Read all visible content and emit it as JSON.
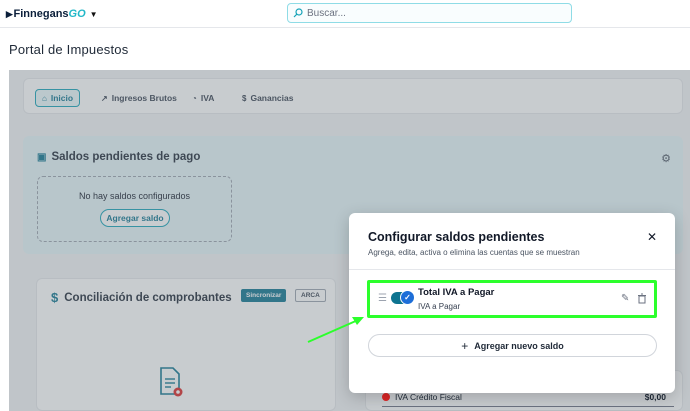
{
  "app": {
    "brand": "Finnegans",
    "brand_suffix": "GO"
  },
  "search": {
    "placeholder": "Buscar..."
  },
  "page": {
    "title": "Portal de Impuestos"
  },
  "tabs": [
    {
      "label": "Inicio",
      "icon": "home-icon",
      "active": true
    },
    {
      "label": "Ingresos Brutos",
      "icon": "trending-up-icon",
      "active": false
    },
    {
      "label": "IVA",
      "icon": "pie-chart-icon",
      "active": false
    },
    {
      "label": "Ganancias",
      "icon": "dollar-icon",
      "active": false
    }
  ],
  "saldos": {
    "title": "Saldos pendientes de pago",
    "empty_text": "No hay saldos configurados",
    "add_button": "Agregar saldo"
  },
  "conciliacion": {
    "title": "Conciliación de comprobantes",
    "sync_button": "Sincronizar",
    "arca_button": "ARCA"
  },
  "iva_row": {
    "label": "IVA Crédito Fiscal",
    "amount": "$0,00"
  },
  "modal": {
    "title": "Configurar saldos pendientes",
    "subtitle": "Agrega, edita, activa o elimina las cuentas que se muestran",
    "items": [
      {
        "title": "Total IVA a Pagar",
        "subtitle": "IVA a Pagar",
        "active": true
      }
    ],
    "add_new": "Agregar nuevo saldo"
  },
  "colors": {
    "accent": "#16a3b8",
    "highlight": "#2cff2c",
    "primary": "#0e7490"
  }
}
